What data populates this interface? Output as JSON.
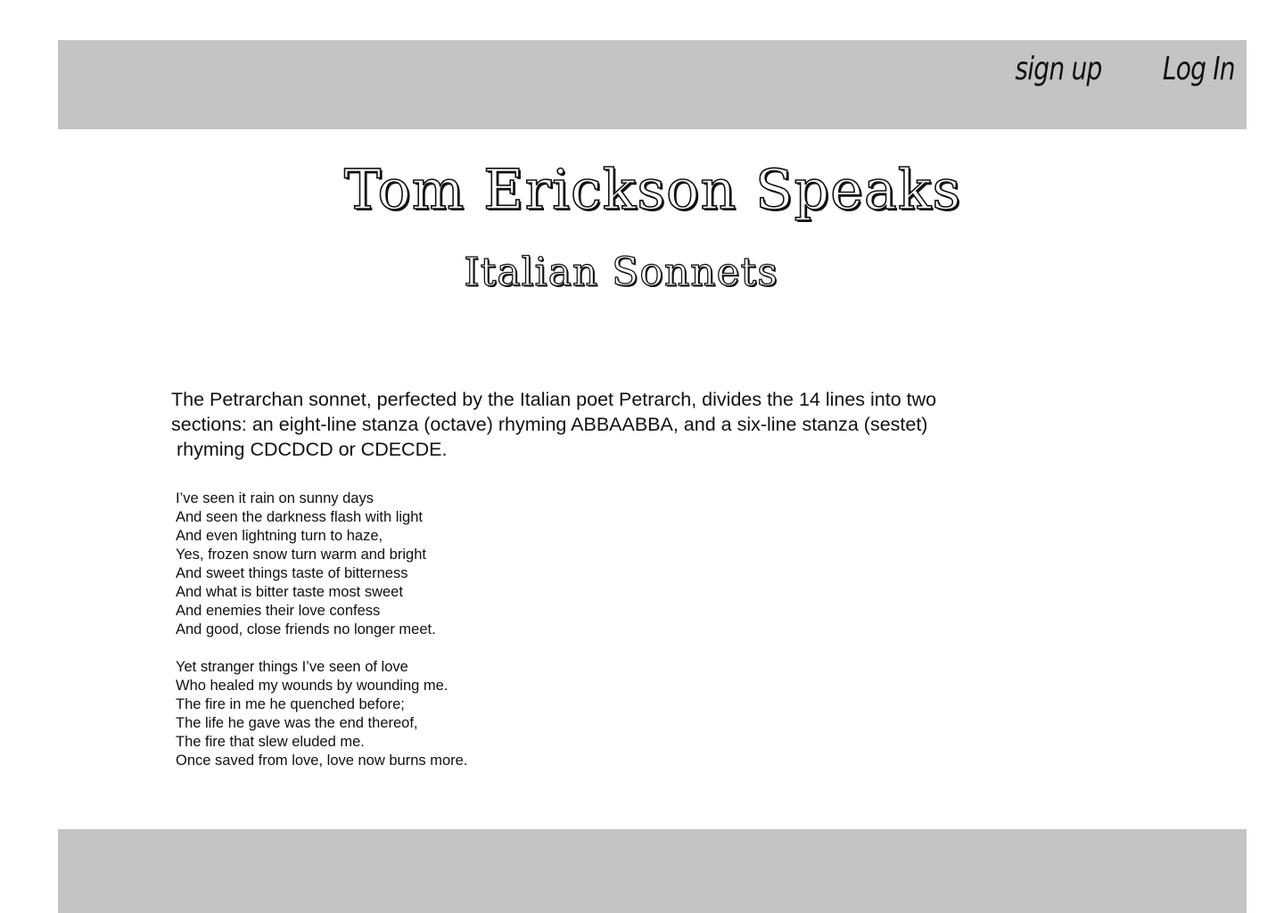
{
  "header": {
    "nav": {
      "sign_up_label": "sign up",
      "log_in_label": "Log In"
    }
  },
  "main": {
    "site_title": "Tom Erickson Speaks",
    "page_subtitle": "Italian Sonnets",
    "intro_lines": [
      "The Petrarchan sonnet, perfected by the Italian poet Petrarch, divides the 14 lines into two",
      "sections: an eight-line stanza (octave) rhyming ABBAABBA, and a six-line stanza (sestet)",
      "rhyming CDCDCD or CDECDE."
    ],
    "poem": {
      "octave": [
        "I’ve seen it rain on sunny days",
        "And seen the darkness flash with light",
        "And even lightning turn to haze,",
        "Yes, frozen snow turn warm and bright",
        "And sweet things taste of bitterness",
        "And what is bitter taste most sweet",
        "And enemies their love confess",
        "And good, close friends no longer meet."
      ],
      "sestet": [
        "Yet stranger things I’ve seen of love",
        "Who healed my wounds by wounding me.",
        "The fire in me he quenched before;",
        "The life he gave was the end thereof,",
        "The fire that slew eluded me.",
        "Once saved from love, love now burns more."
      ]
    }
  },
  "colors": {
    "bar_background": "#c4c4c4",
    "text": "#111111",
    "page_background": "#ffffff"
  }
}
